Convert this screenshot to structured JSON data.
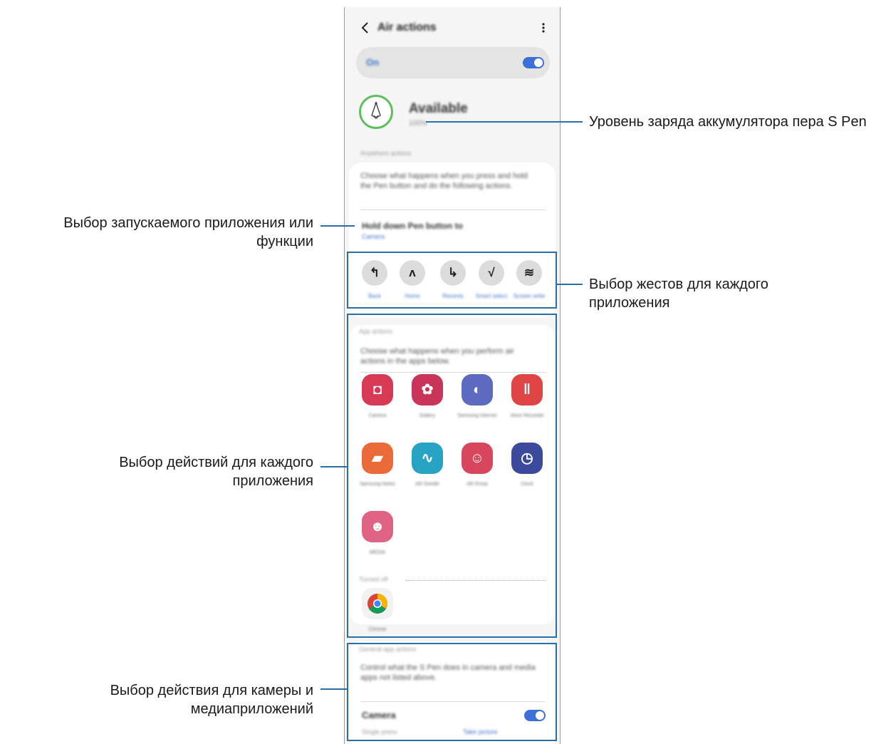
{
  "screen": {
    "title": "Air actions",
    "on_label": "On",
    "status": "Available",
    "battery": "100%",
    "anywhere_label": "Anywhere actions",
    "anywhere_desc": "Choose what happens when you press and hold the Pen button and do the following actions.",
    "hold_label": "Hold down Pen button to",
    "hold_value": "Camera",
    "gestures": [
      {
        "glyph": "↰",
        "label": "Back"
      },
      {
        "glyph": "ʌ",
        "label": "Home"
      },
      {
        "glyph": "↳",
        "label": "Recents"
      },
      {
        "glyph": "√",
        "label": "Smart select"
      },
      {
        "glyph": "≋",
        "label": "Screen write"
      }
    ],
    "app_actions_label": "App actions",
    "app_actions_desc": "Choose what happens when you perform air actions in the apps below.",
    "apps": [
      {
        "name": "Camera",
        "icon": "camera-icon",
        "color": "#d83a56",
        "glyph": "◘"
      },
      {
        "name": "Gallery",
        "icon": "gallery-icon",
        "color": "#c9345a",
        "glyph": "✿"
      },
      {
        "name": "Samsung Internet",
        "icon": "internet-icon",
        "color": "#5c6bc0",
        "glyph": "◐"
      },
      {
        "name": "Voice Recorder",
        "icon": "recorder-icon",
        "color": "#e04545",
        "glyph": "‖"
      },
      {
        "name": "Samsung Notes",
        "icon": "notes-icon",
        "color": "#ea6a3a",
        "glyph": "▰"
      },
      {
        "name": "AR Doodle",
        "icon": "ar-doodle-icon",
        "color": "#27a3c4",
        "glyph": "∿"
      },
      {
        "name": "AR Emoji",
        "icon": "ar-emoji-icon",
        "color": "#d8465d",
        "glyph": "☺"
      },
      {
        "name": "Clock",
        "icon": "clock-icon",
        "color": "#3c4a9e",
        "glyph": "◷"
      },
      {
        "name": "MEDIA",
        "icon": "media-icon",
        "color": "#e06383",
        "glyph": "☻"
      }
    ],
    "turned_off_label": "Turned off",
    "chrome": {
      "name": "Chrome",
      "icon": "chrome-icon"
    },
    "general_label": "General app actions",
    "general_desc": "Control what the S Pen does in camera and media apps not listed above.",
    "camera_label": "Camera",
    "single_press_label": "Single press",
    "single_press_value": "Take picture"
  },
  "annotations": {
    "battery": "Уровень заряда аккумулятора пера S Pen",
    "launch_app_line1": "Выбор запускаемого приложения или",
    "launch_app_line2": "функции",
    "gestures_line1": "Выбор жестов для каждого",
    "gestures_line2": "приложения",
    "app_actions_line1": "Выбор действий для каждого",
    "app_actions_line2": "приложения",
    "media_line1": "Выбор действия для камеры и",
    "media_line2": "медиаприложений"
  },
  "colors": {
    "accent": "#2a6fa7",
    "toggle": "#3d6fd9",
    "battery_ring": "#5cc15a"
  }
}
